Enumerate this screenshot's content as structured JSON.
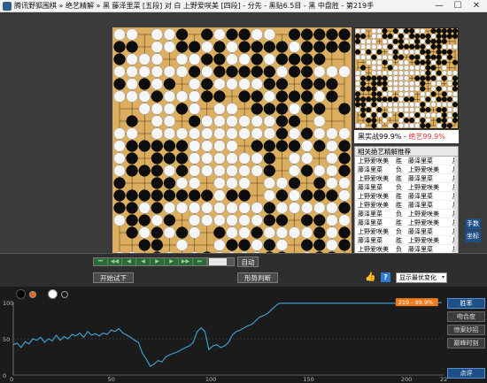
{
  "window": {
    "title": "腾讯野狐围棋 » 绝艺精解 » 黑 藤泽里菜 [五段] 对 白 上野爱咲美 [四段] - 分先 - 黑贴6.5目 - 黑 中盘胜 - 第219手",
    "minimize": "—",
    "maximize": "☐",
    "close": "✕"
  },
  "board": {
    "size": 19
  },
  "preview": {
    "caption_black": "黑实战99.9%",
    "caption_sep": " - ",
    "caption_red": "绝艺99.9%"
  },
  "recommendations": {
    "header": "相关绝艺精解推荐",
    "rows": [
      {
        "p1": "上野爱咲美",
        "r": "胜",
        "p2": "藤泽里菜",
        "x": "屏"
      },
      {
        "p1": "藤泽里菜",
        "r": "负",
        "p2": "上野爱咲美",
        "x": "屏"
      },
      {
        "p1": "上野爱咲美",
        "r": "胜",
        "p2": "藤泽里菜",
        "x": "屏"
      },
      {
        "p1": "藤泽里菜",
        "r": "负",
        "p2": "上野爱咲美",
        "x": "屏"
      },
      {
        "p1": "上野爱咲美",
        "r": "胜",
        "p2": "藤泽里菜",
        "x": "屏"
      },
      {
        "p1": "上野爱咲美",
        "r": "胜",
        "p2": "藤泽里菜",
        "x": "屏"
      },
      {
        "p1": "藤泽里菜",
        "r": "负",
        "p2": "上野爱咲美",
        "x": "屏"
      },
      {
        "p1": "藤泽里菜",
        "r": "胜",
        "p2": "上野爱咲美",
        "x": "屏"
      },
      {
        "p1": "上野爱咲美",
        "r": "负",
        "p2": "藤泽里菜",
        "x": "屏"
      },
      {
        "p1": "藤泽里菜",
        "r": "胜",
        "p2": "上野爱咲美",
        "x": "屏"
      },
      {
        "p1": "上野爱咲美",
        "r": "负",
        "p2": "藤泽里菜",
        "x": "屏"
      },
      {
        "p1": "藤泽里菜",
        "r": "胜",
        "p2": "上野爱咲美",
        "x": "屏"
      }
    ]
  },
  "side_tabs": {
    "tab1": "手数",
    "tab2": "坐标"
  },
  "controls": {
    "nav_buttons": [
      "⏮",
      "◀◀",
      "◀",
      "◀",
      "▶",
      "▶",
      "▶▶",
      "⏭"
    ],
    "auto": "自动",
    "trial": "开始试下",
    "judge": "形势判断",
    "thumb": "👍",
    "help": "?",
    "dropdown": "显示最优变化",
    "dropdown_arrow": "▾"
  },
  "chart_data": {
    "type": "line",
    "title": "",
    "xlabel": "",
    "ylabel": "",
    "xlim": [
      0,
      220
    ],
    "ylim": [
      0,
      100
    ],
    "x_ticks": [
      "0",
      "50",
      "100",
      "150",
      "200",
      "220"
    ],
    "y_ticks": [
      "100",
      "50",
      "0"
    ],
    "current_label": "219 - 99.9%",
    "series": [
      {
        "color": "#3ea6e0",
        "x": [
          0,
          2,
          4,
          6,
          8,
          10,
          12,
          14,
          16,
          18,
          20,
          22,
          24,
          26,
          28,
          30,
          32,
          34,
          36,
          38,
          40,
          42,
          44,
          46,
          48,
          50,
          52,
          54,
          56,
          58,
          60,
          62,
          64,
          66,
          68,
          70,
          72,
          74,
          76,
          78,
          80,
          82,
          84,
          86,
          88,
          90,
          92,
          94,
          96,
          98,
          100,
          102,
          104,
          106,
          108,
          110,
          112,
          114,
          116,
          118,
          120,
          122,
          124,
          126,
          128,
          130,
          132,
          134,
          136,
          138,
          140,
          142,
          144,
          146,
          148,
          150,
          155,
          160,
          170,
          180,
          190,
          200,
          210,
          219
        ],
        "y": [
          42,
          44,
          38,
          46,
          43,
          50,
          48,
          52,
          45,
          50,
          47,
          55,
          48,
          53,
          50,
          56,
          54,
          58,
          52,
          60,
          55,
          57,
          54,
          58,
          56,
          62,
          60,
          64,
          58,
          55,
          52,
          48,
          45,
          30,
          22,
          12,
          15,
          20,
          18,
          25,
          28,
          30,
          32,
          35,
          38,
          40,
          45,
          60,
          65,
          60,
          35,
          40,
          42,
          38,
          40,
          45,
          55,
          60,
          62,
          65,
          68,
          70,
          75,
          80,
          82,
          85,
          90,
          95,
          99,
          99,
          99,
          99,
          99,
          99,
          99,
          99,
          99,
          99,
          99,
          99,
          99,
          99,
          99,
          99.9
        ]
      }
    ]
  },
  "right_panel": {
    "btn1": "胜率",
    "btn2": "吻合度",
    "btn3": "惊案妙招",
    "btn4": "巅峰时刻",
    "bottom": "点评"
  },
  "colors": {
    "board": "#dcae5f",
    "accent": "#1e4f86",
    "line": "#3ea6e0",
    "label_bg": "#f27a1a"
  }
}
